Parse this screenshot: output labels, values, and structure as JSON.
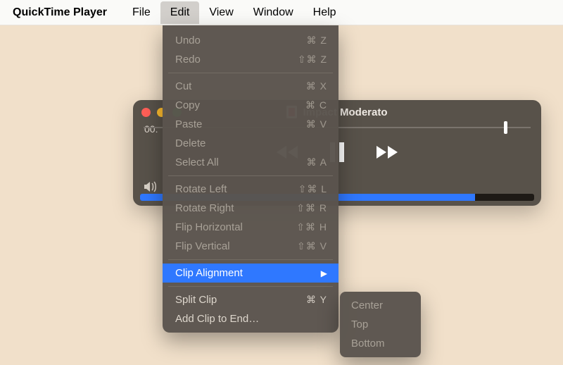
{
  "menubar": {
    "app_name": "QuickTime Player",
    "items": [
      "File",
      "Edit",
      "View",
      "Window",
      "Help"
    ],
    "open_index": 1
  },
  "player": {
    "title": "Impact Moderato",
    "time": "00:",
    "progress_pct": 85,
    "playhead_pct": 93
  },
  "edit_menu": {
    "groups": [
      [
        {
          "label": "Undo",
          "shortcut": "⌘ Z",
          "enabled": false
        },
        {
          "label": "Redo",
          "shortcut": "⇧⌘ Z",
          "enabled": false
        }
      ],
      [
        {
          "label": "Cut",
          "shortcut": "⌘ X",
          "enabled": false
        },
        {
          "label": "Copy",
          "shortcut": "⌘ C",
          "enabled": false
        },
        {
          "label": "Paste",
          "shortcut": "⌘ V",
          "enabled": false
        },
        {
          "label": "Delete",
          "shortcut": "",
          "enabled": false
        },
        {
          "label": "Select All",
          "shortcut": "⌘ A",
          "enabled": false
        }
      ],
      [
        {
          "label": "Rotate Left",
          "shortcut": "⇧⌘ L",
          "enabled": false
        },
        {
          "label": "Rotate Right",
          "shortcut": "⇧⌘ R",
          "enabled": false
        },
        {
          "label": "Flip Horizontal",
          "shortcut": "⇧⌘ H",
          "enabled": false
        },
        {
          "label": "Flip Vertical",
          "shortcut": "⇧⌘ V",
          "enabled": false
        }
      ],
      [
        {
          "label": "Clip Alignment",
          "shortcut": "",
          "enabled": true,
          "submenu": true,
          "highlight": true
        }
      ],
      [
        {
          "label": "Split Clip",
          "shortcut": "⌘ Y",
          "enabled": true
        },
        {
          "label": "Add Clip to End…",
          "shortcut": "",
          "enabled": true
        }
      ]
    ]
  },
  "clip_alignment_submenu": {
    "items": [
      {
        "label": "Center",
        "enabled": false
      },
      {
        "label": "Top",
        "enabled": false
      },
      {
        "label": "Bottom",
        "enabled": false
      }
    ]
  }
}
